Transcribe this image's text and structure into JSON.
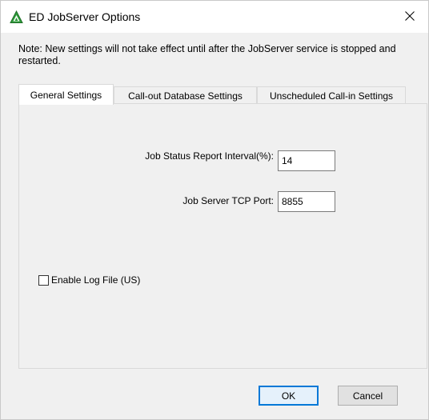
{
  "window": {
    "title": "ED JobServer Options",
    "close_glyph": "✕",
    "icon": "app-triangle-icon"
  },
  "note": "Note: New settings will not take effect until after the JobServer service is stopped and restarted.",
  "tabs": [
    {
      "label": "General Settings",
      "active": true
    },
    {
      "label": "Call-out Database Settings",
      "active": false
    },
    {
      "label": "Unscheduled Call-in Settings",
      "active": false
    }
  ],
  "general": {
    "status_interval_label": "Job Status Report Interval(%):",
    "status_interval_value": "14",
    "tcp_port_label": "Job Server TCP Port:",
    "tcp_port_value": "8855",
    "enable_log_label": "Enable Log File (US)",
    "enable_log_checked": false
  },
  "buttons": {
    "ok": "OK",
    "cancel": "Cancel"
  },
  "colors": {
    "accent": "#0078d7",
    "icon_green": "#2e9b3a"
  }
}
